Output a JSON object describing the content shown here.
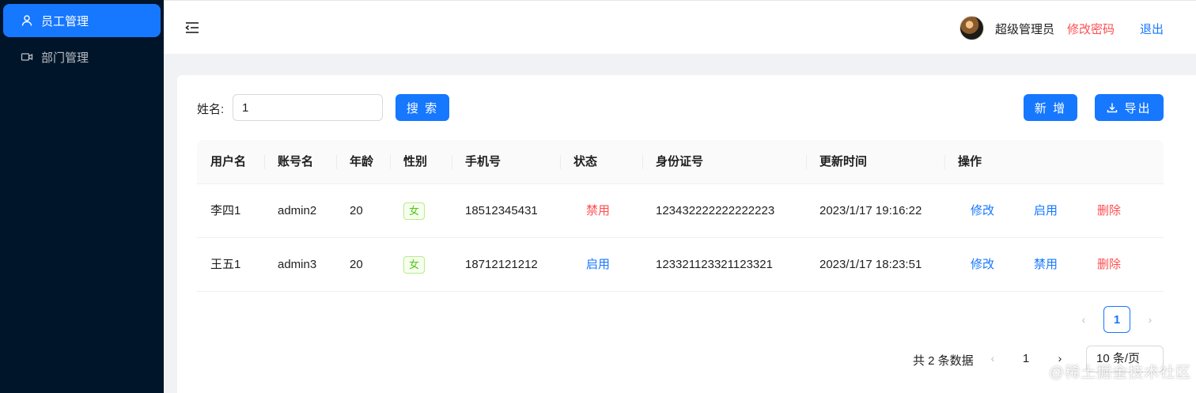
{
  "sidebar": {
    "items": [
      {
        "label": "员工管理",
        "icon": "user-icon",
        "active": true
      },
      {
        "label": "部门管理",
        "icon": "video-camera-icon",
        "active": false
      }
    ]
  },
  "header": {
    "collapse_icon": "menu-fold-icon",
    "username": "超级管理员",
    "change_password": "修改密码",
    "logout": "退出"
  },
  "search": {
    "label": "姓名:",
    "value": "1",
    "button": "搜 索"
  },
  "toolbar": {
    "add_label": "新 增",
    "export_label": "导出",
    "export_icon": "download-icon"
  },
  "table": {
    "columns": [
      "用户名",
      "账号名",
      "年龄",
      "性别",
      "手机号",
      "状态",
      "身份证号",
      "更新时间",
      "操作"
    ],
    "rows": [
      {
        "username": "李四1",
        "account": "admin2",
        "age": "20",
        "gender": "女",
        "phone": "18512345431",
        "status": "禁用",
        "id_number": "123432222222222223",
        "updated": "2023/1/17 19:16:22",
        "actions": [
          "修改",
          "启用",
          "删除"
        ]
      },
      {
        "username": "王五1",
        "account": "admin3",
        "age": "20",
        "gender": "女",
        "phone": "18712121212",
        "status": "启用",
        "id_number": "123321123321123321",
        "updated": "2023/1/17 18:23:51",
        "actions": [
          "修改",
          "禁用",
          "删除"
        ]
      }
    ]
  },
  "pagination_top": {
    "current_page": "1",
    "prev": "‹",
    "next": "›"
  },
  "pagination_bottom": {
    "total_text": "共 2 条数据",
    "prev": "‹",
    "page": "1",
    "next": "›",
    "page_size": "10 条/页"
  },
  "watermark": "@稀土掘金技术社区",
  "colors": {
    "primary": "#1677ff",
    "danger": "#ff4d4f",
    "sidebar_bg": "#001529",
    "tag_green": "#52c41a"
  }
}
